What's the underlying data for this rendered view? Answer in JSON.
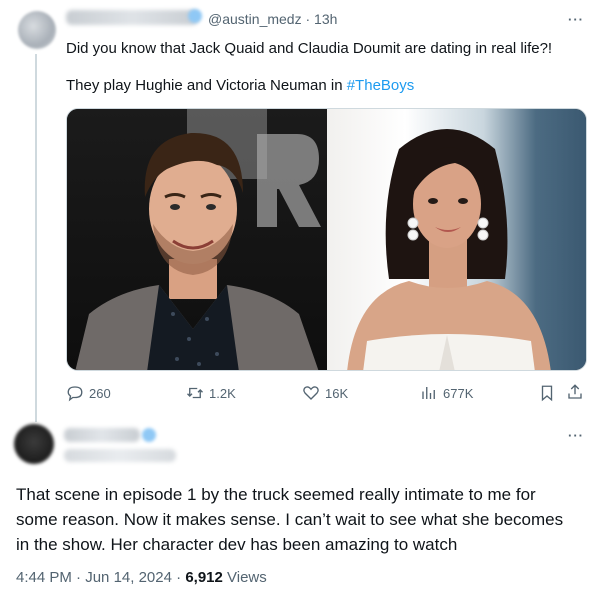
{
  "tweet": {
    "handle": "@austin_medz",
    "time_sep": "·",
    "time": "13h",
    "more_label": "···",
    "line1": "Did you know that Jack Quaid and Claudia Doumit are dating in real life?!",
    "line2_prefix": "They play Hughie and Victoria Neuman in ",
    "hashtag": "#TheBoys",
    "media": {
      "left_photo": "man-portrait-photo",
      "right_photo": "woman-portrait-photo"
    },
    "actions": {
      "replies": "260",
      "retweets": "1.2K",
      "likes": "16K",
      "views": "677K"
    },
    "link_color": "#1d9bf0"
  },
  "reply": {
    "more_label": "···",
    "lines": [
      "That scene in episode 1 by the truck seemed really intimate to me for",
      "some reason. Now it makes sense. I can’t wait to see what she becomes",
      "in the show. Her character dev has been amazing to watch"
    ],
    "time": "4:44 PM",
    "sep1": " · ",
    "date": "Jun 14, 2024",
    "sep2": " · ",
    "views_count": "6,912",
    "views_label": " Views"
  }
}
